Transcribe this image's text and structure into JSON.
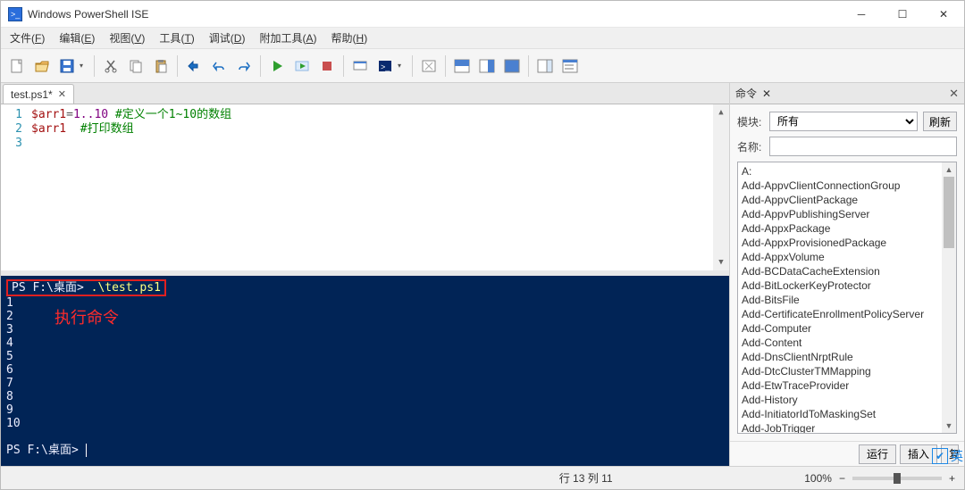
{
  "titlebar": {
    "title": "Windows PowerShell ISE"
  },
  "menubar": {
    "file": {
      "label": "文件",
      "key": "F"
    },
    "edit": {
      "label": "编辑",
      "key": "E"
    },
    "view": {
      "label": "视图",
      "key": "V"
    },
    "tools": {
      "label": "工具",
      "key": "T"
    },
    "debug": {
      "label": "调试",
      "key": "D"
    },
    "addons": {
      "label": "附加工具",
      "key": "A"
    },
    "help": {
      "label": "帮助",
      "key": "H"
    }
  },
  "tabs": [
    {
      "label": "test.ps1*"
    }
  ],
  "editor": {
    "lines": [
      {
        "num": "1",
        "var": "$arr1",
        "op": "=",
        "rng": "1..10",
        "comment": " #定义一个1~10的数组"
      },
      {
        "num": "2",
        "var": "$arr1",
        "op": "",
        "rng": "",
        "comment": "  #打印数组"
      },
      {
        "num": "3",
        "var": "",
        "op": "",
        "rng": "",
        "comment": ""
      }
    ]
  },
  "console": {
    "prompt_prefix": "PS F:\\桌面> ",
    "first_cmd": ".\\test.ps1",
    "output": [
      "1",
      "2",
      "3",
      "4",
      "5",
      "6",
      "7",
      "8",
      "9",
      "10"
    ],
    "prompt2": "PS F:\\桌面> ",
    "annotation": "执行命令"
  },
  "commands": {
    "panel_title": "命令",
    "module_label": "模块:",
    "module_selected": "所有",
    "refresh_label": "刷新",
    "name_label": "名称:",
    "name_value": "",
    "items": [
      "A:",
      "Add-AppvClientConnectionGroup",
      "Add-AppvClientPackage",
      "Add-AppvPublishingServer",
      "Add-AppxPackage",
      "Add-AppxProvisionedPackage",
      "Add-AppxVolume",
      "Add-BCDataCacheExtension",
      "Add-BitLockerKeyProtector",
      "Add-BitsFile",
      "Add-CertificateEnrollmentPolicyServer",
      "Add-Computer",
      "Add-Content",
      "Add-DnsClientNrptRule",
      "Add-DtcClusterTMMapping",
      "Add-EtwTraceProvider",
      "Add-History",
      "Add-InitiatorIdToMaskingSet",
      "Add-JobTrigger"
    ],
    "run_label": "运行",
    "insert_label": "插入",
    "copy_label": "复"
  },
  "ime": {
    "lang": "英"
  },
  "statusbar": {
    "cursor": "行 13  列 11",
    "zoom": "100%"
  }
}
